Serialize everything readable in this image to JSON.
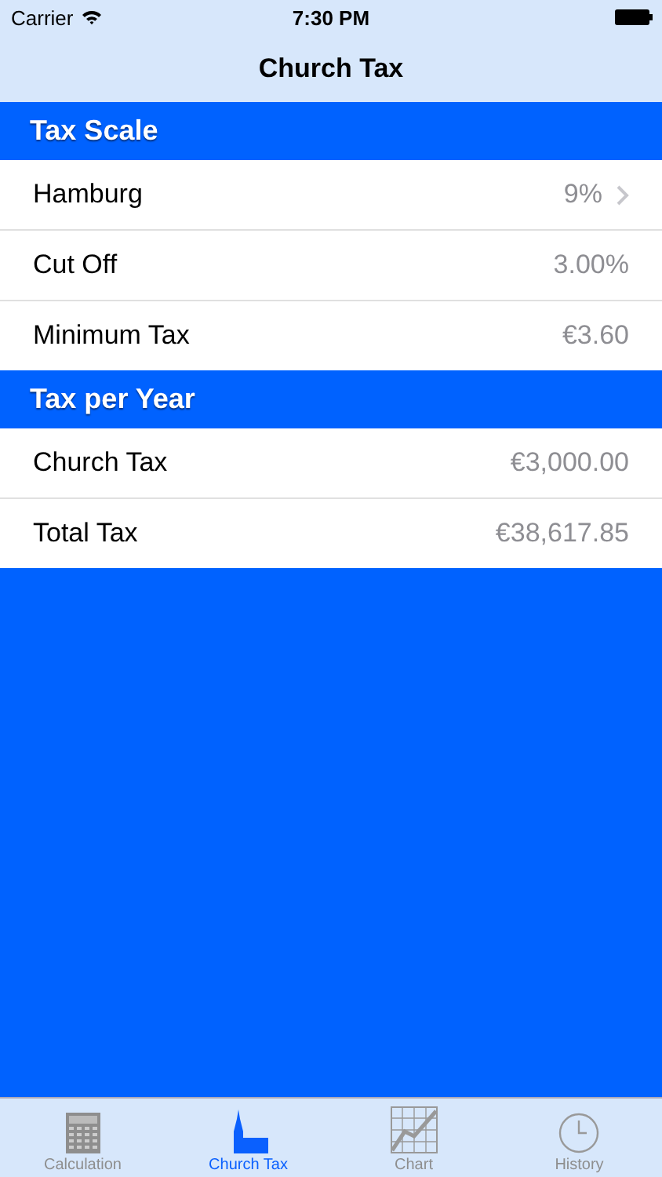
{
  "status_bar": {
    "carrier": "Carrier",
    "time": "7:30 PM"
  },
  "nav_bar": {
    "title": "Church Tax"
  },
  "sections": [
    {
      "header": "Tax Scale",
      "rows": [
        {
          "label": "Hamburg",
          "value": "9%",
          "kind": "disclosure"
        },
        {
          "label": "Cut Off",
          "value": "3.00%",
          "kind": "plain"
        },
        {
          "label": "Minimum Tax",
          "value": "€3.60",
          "kind": "plain"
        }
      ]
    },
    {
      "header": "Tax per Year",
      "rows": [
        {
          "label": "Church Tax",
          "value": "€3,000.00",
          "kind": "plain"
        },
        {
          "label": "Total Tax",
          "value": "€38,617.85",
          "kind": "plain"
        }
      ]
    }
  ],
  "tab_bar": [
    {
      "label": "Calculation",
      "selected": false
    },
    {
      "label": "Church Tax",
      "selected": true
    },
    {
      "label": "Chart",
      "selected": false
    },
    {
      "label": "History",
      "selected": false
    }
  ]
}
